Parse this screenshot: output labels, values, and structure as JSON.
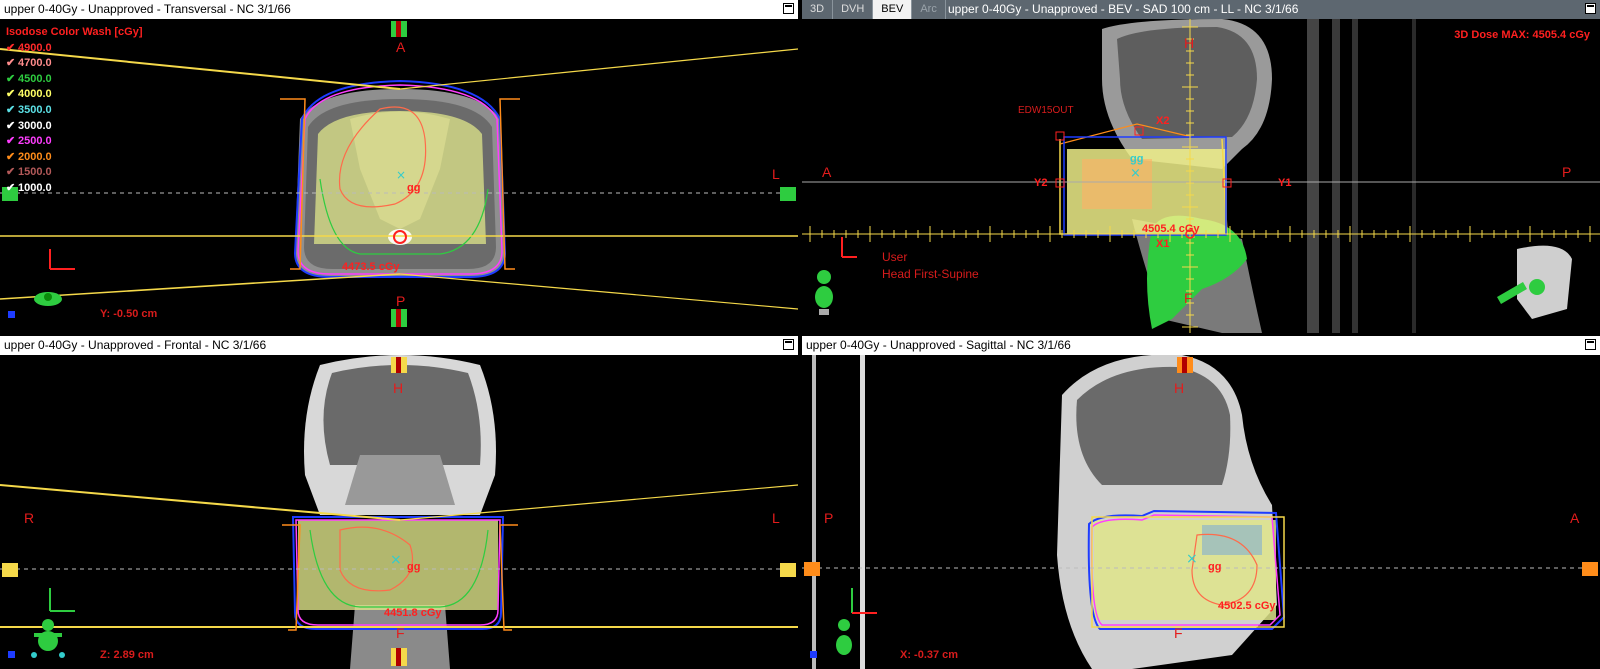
{
  "panes": {
    "transversal": {
      "title": "upper 0-40Gy  -  Unapproved - Transversal - NC 3/1/66",
      "legend_title": "Isodose Color Wash [cGy]",
      "isodoses": [
        {
          "label": "4900.0",
          "color": "#ff2a2a"
        },
        {
          "label": "4700.0",
          "color": "#ff8c8c"
        },
        {
          "label": "4500.0",
          "color": "#2ecc40"
        },
        {
          "label": "4000.0",
          "color": "#ffff66"
        },
        {
          "label": "3500.0",
          "color": "#5ce1e6"
        },
        {
          "label": "3000.0",
          "color": "#ffffff"
        },
        {
          "label": "2500.0",
          "color": "#ff3dff"
        },
        {
          "label": "2000.0",
          "color": "#ff8c1a"
        },
        {
          "label": "1500.0",
          "color": "#b35959"
        },
        {
          "label": "1000.0",
          "color": "#ffffff"
        }
      ],
      "orient": {
        "top": "A",
        "bottom": "P",
        "right": "L"
      },
      "target_label": "gg",
      "dose_point": "4473.5 cGy",
      "slice_pos": "Y: -0.50 cm"
    },
    "bev": {
      "tabs": [
        "3D",
        "DVH",
        "BEV",
        "Arc"
      ],
      "title": "upper 0-40Gy - Unapproved - BEV - SAD 100 cm - LL - NC 3/1/66",
      "dose_max": "3D Dose MAX: 4505.4 cGy",
      "wedge": "EDW15OUT",
      "orient": {
        "top": "H",
        "bottom": "F",
        "left": "A",
        "right": "P"
      },
      "jaws": {
        "x2": "X2",
        "x1": "X1",
        "y2": "Y2",
        "y1": "Y1"
      },
      "target_label": "gg",
      "dose_point": "4505.4 cGy",
      "user": "User",
      "position": "Head First-Supine"
    },
    "frontal": {
      "title": "upper 0-40Gy  -  Unapproved - Frontal - NC 3/1/66",
      "orient": {
        "top": "H",
        "bottom": "F",
        "left": "R",
        "right": "L"
      },
      "target_label": "gg",
      "dose_point": "4451.8 cGy",
      "slice_pos": "Z: 2.89 cm"
    },
    "sagittal": {
      "title": "upper 0-40Gy  -  Unapproved - Sagittal - NC 3/1/66",
      "orient": {
        "top": "H",
        "bottom": "F",
        "left": "P",
        "right": "A"
      },
      "target_label": "gg",
      "dose_point": "4502.5 cGy",
      "slice_pos": "X: -0.37 cm"
    }
  },
  "colors": {
    "orient_label": "#e41c1c",
    "beam_line": "#f5d94a",
    "body_contour": "#1e3cff",
    "ptv_wash": "#dfe58a"
  }
}
